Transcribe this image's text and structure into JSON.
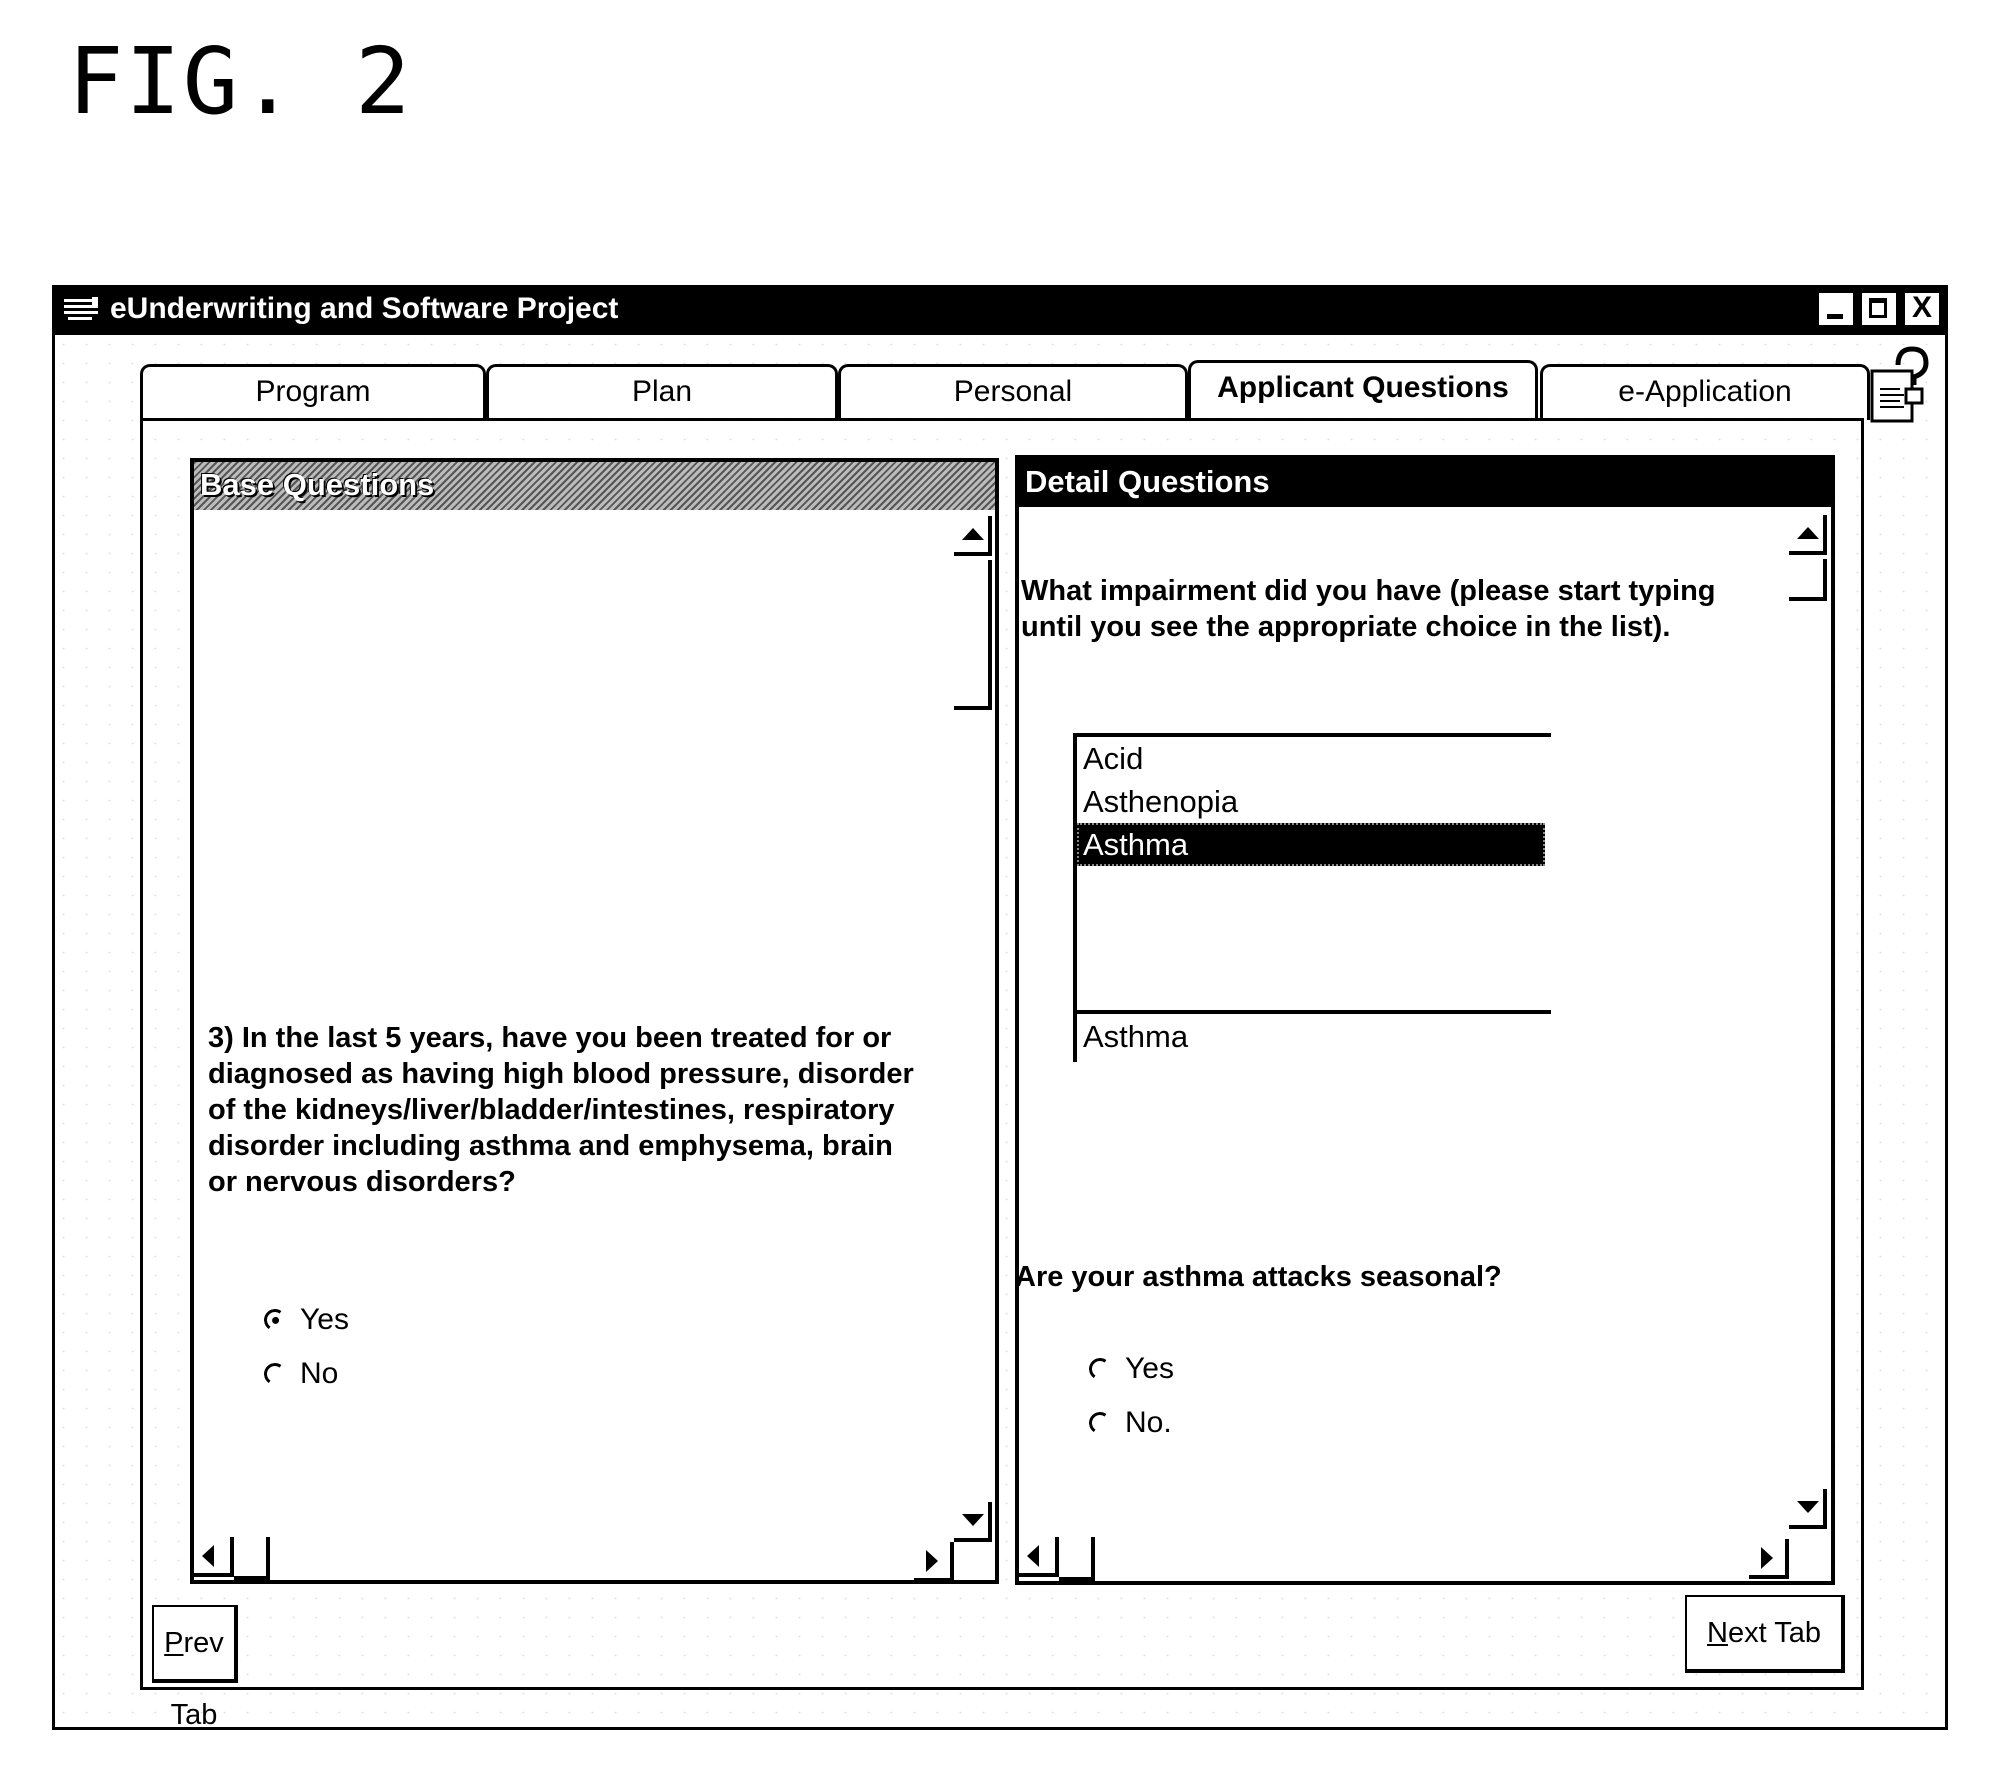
{
  "figure_label": "FIG. 2",
  "window": {
    "title": "eUnderwriting and Software Project",
    "controls": {
      "minimize": "minimize",
      "maximize": "maximize",
      "close": "X"
    }
  },
  "tabs": [
    {
      "label": "Program",
      "active": false
    },
    {
      "label": "Plan",
      "active": false
    },
    {
      "label": "Personal",
      "active": false
    },
    {
      "label": "Applicant Questions",
      "active": true
    },
    {
      "label": "e-Application",
      "active": false
    }
  ],
  "help_icon": "help-document-icon",
  "base_questions": {
    "header": "Base Questions",
    "question": "3)   In the last 5 years, have you been treated for or diagnosed as having high blood pressure, disorder of the kidneys/liver/bladder/intestines, respiratory disorder including asthma and emphysema, brain or nervous disorders?",
    "options": [
      {
        "label": "Yes",
        "checked": true
      },
      {
        "label": "No",
        "checked": false
      }
    ]
  },
  "detail_questions": {
    "header": "Detail Questions",
    "impairment_prompt": "What impairment did you have (please start typing until you see the appropriate choice in the list).",
    "impairment_list": [
      "Acid",
      "Asthenopia",
      "Asthma"
    ],
    "selected_impairment": "Asthma",
    "impairment_input_value": "Asthma",
    "followup_question": "Are your asthma attacks seasonal?",
    "followup_options": [
      {
        "label": "Yes",
        "checked": false
      },
      {
        "label": "No.",
        "checked": false
      }
    ]
  },
  "buttons": {
    "prev_tab": {
      "mnemonic": "P",
      "rest": "rev Tab"
    },
    "next_tab": {
      "mnemonic": "N",
      "rest": "ext Tab"
    }
  }
}
